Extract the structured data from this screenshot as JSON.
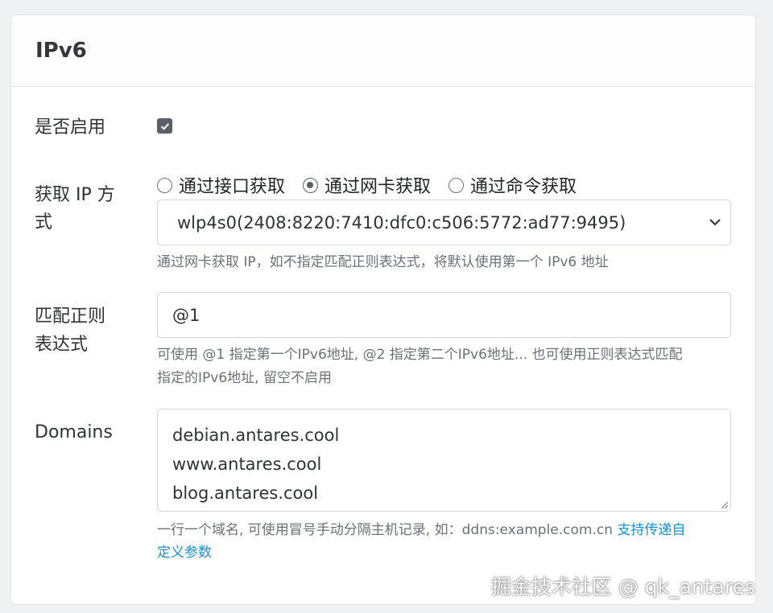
{
  "card": {
    "title": "IPv6"
  },
  "enable": {
    "label": "是否启用",
    "checked": true
  },
  "ip_method": {
    "label_line1": "获取 IP 方",
    "label_line2": "式",
    "options": [
      {
        "label": "通过接口获取",
        "checked": false
      },
      {
        "label": "通过网卡获取",
        "checked": true
      },
      {
        "label": "通过命令获取",
        "checked": false
      }
    ],
    "select_value": "wlp4s0(2408:8220:7410:dfc0:c506:5772:ad77:9495)",
    "help": "通过网卡获取 IP，如不指定匹配正则表达式，将默认使用第一个 IPv6 地址"
  },
  "regex": {
    "label_line1": "匹配正则",
    "label_line2": "表达式",
    "value": "@1",
    "help_line1": "可使用 @1 指定第一个IPv6地址, @2 指定第二个IPv6地址... 也可使用正则表达式匹配",
    "help_line2": "指定的IPv6地址, 留空不启用"
  },
  "domains": {
    "label": "Domains",
    "lines": [
      "debian.antares.cool",
      "www.antares.cool",
      "blog.antares.cool"
    ],
    "help_text": "一行一个域名, 可使用冒号手动分隔主机记录, 如：ddns:example.com.cn ",
    "help_link_part1": "支持传递自",
    "help_link_part2": "定义参数"
  },
  "watermark": "掘金技术社区 @ qk_antares",
  "colors": {
    "link": "#1a8fd0",
    "checkbox": "#5a6068"
  }
}
